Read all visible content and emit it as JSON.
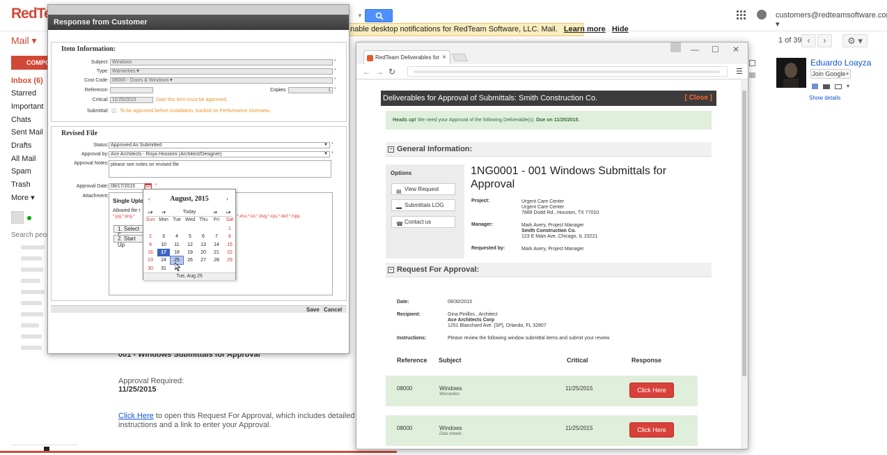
{
  "gmail": {
    "logo": "RedTe",
    "account_email": "customers@redteamsoftware.com",
    "mail_label": "Mail",
    "compose_label": "COMPOS",
    "notification": {
      "text": "nable desktop notifications for RedTeam Software, LLC. Mail.",
      "learn_more": "Learn more",
      "hide": "Hide"
    },
    "pager": {
      "text": "1 of 39",
      "prev": "‹",
      "next": "›"
    },
    "nav": [
      "Inbox (6)",
      "Starred",
      "Important",
      "Chats",
      "Sent Mail",
      "Drafts",
      "All Mail",
      "Spam",
      "Trash",
      "More"
    ],
    "people_search_placeholder": "Search peop",
    "email": {
      "subject": "001 - Windows Submittals for Approval",
      "approval_required_label": "Approval Required:",
      "approval_date": "11/25/2015",
      "link_text": "Click Here",
      "link_rest": " to open this Request For Approval, which includes detailed instructions and a link to enter your Approval."
    },
    "contact": {
      "name": "Eduardo Loayza",
      "join_label": "Join Google+",
      "show_details": "Show details"
    },
    "colors": {
      "brand_red": "#d14836",
      "link_blue": "#1155cc"
    }
  },
  "response_dialog": {
    "title": "Response from Customer",
    "item_info": {
      "legend": "Item Information:",
      "subject_label": "Subject:",
      "subject_value": "Windows",
      "type_label": "Type:",
      "type_value": "Warranties",
      "cost_code_label": "Cost Code:",
      "cost_code_value": "08000 - Doors & Windows",
      "reference_label": "Reference:",
      "reference_value": "",
      "copies_label": "Copies:",
      "copies_value": "1",
      "critical_label": "Critical:",
      "critical_value": "11/25/2015",
      "critical_note": "Date this item must be approved.",
      "submittal_label": "Submittal:",
      "submittal_note": "To be approved before installation, tracked on Performance Overview."
    },
    "revised_file": {
      "legend": "Revised File",
      "status_label": "Status:",
      "status_value": "Approved As Submitted",
      "approval_by_label": "Approval by:",
      "approval_by_value": "Ace Architects - Roya Hosseini (Architect/Designer)",
      "notes_label": "Approval Notes:",
      "notes_value": "please see notes on revised file",
      "date_label": "Approval Date:",
      "date_value": "08/17/2015",
      "attachment_label": "Attachment:",
      "upload_title": "Single Uploa",
      "allowed_prefix": "Allowed file t",
      "filetypes_a": "*.jpg,*.png,*",
      "filetypes_b": "*.xlsx,*.txt,*.dwg,*.xps,*.dwf,*.mpp,",
      "select_btn": "1. Select F",
      "start_btn": "2. Start Up"
    },
    "buttons": {
      "save": "Save",
      "cancel": "Cancel"
    }
  },
  "calendar": {
    "month_label": "August, 2015",
    "prev_month": "‹",
    "next_month": "›",
    "prev_year": "«",
    "prev_month2": "‹",
    "today": "Today",
    "next_month2": "›",
    "next_year": "»",
    "weekdays": [
      "Sun",
      "Mon",
      "Tue",
      "Wed",
      "Thu",
      "Fri",
      "Sat"
    ],
    "selected_day": "17",
    "hover_day": "25",
    "footer": "Tue, Aug 25"
  },
  "browser": {
    "tab_title": "RedTeam Deliverables for",
    "tab_close": "×",
    "win_min": "—",
    "win_max": "☐",
    "win_close": "✕",
    "page": {
      "header": "Deliverables for Approval of Submittals: Smith Construction Co.",
      "close": "[ Close ]",
      "heads_up_bold": "Heads up!",
      "heads_up_text": " We need your Approval of the following Deliverable(s). ",
      "heads_up_due": "Due on 11/25/2015.",
      "general_info": "General Information:",
      "options_title": "Options",
      "options": [
        "View Request",
        "Submittals LOG",
        "Contact us"
      ],
      "request_title": "1NG0001 - 001 Windows Submittals for Approval",
      "project_label": "Project:",
      "project_lines": [
        "Urgent Care Center",
        "Urgent Care Center",
        "7889 Dodd Rd., Houston, TX 77010"
      ],
      "manager_label": "Manager:",
      "manager_lines": [
        "Mark Avery, Project Manager",
        "Smith Construction Co.",
        "123 E Main Ave, Chicago, IL 23221"
      ],
      "requested_by_label": "Requested by:",
      "requested_by_value": "Mark Avery, Project Manager",
      "rfa_header": "Request For Approval:",
      "date_label": "Date:",
      "date_value": "09/30/2015",
      "recipient_label": "Recipient:",
      "recipient_lines": [
        "Gina Pinillos , Architect",
        "Ace Architects Corp",
        "1251 Blanchard Ave. [SP], Orlando, FL 32807"
      ],
      "instructions_label": "Instructions:",
      "instructions_value": "Please review the following window submittal items and submit your review",
      "table_headers": [
        "Reference",
        "Subject",
        "Critical",
        "Response"
      ],
      "rows": [
        {
          "ref": "08000",
          "subject": "Windows",
          "subsubject": "Warranties",
          "critical": "11/25/2015",
          "action": "Click Here"
        },
        {
          "ref": "08000",
          "subject": "Windows",
          "subsubject": "Data sheets",
          "critical": "11/25/2015",
          "action": "Click Here"
        }
      ]
    }
  }
}
